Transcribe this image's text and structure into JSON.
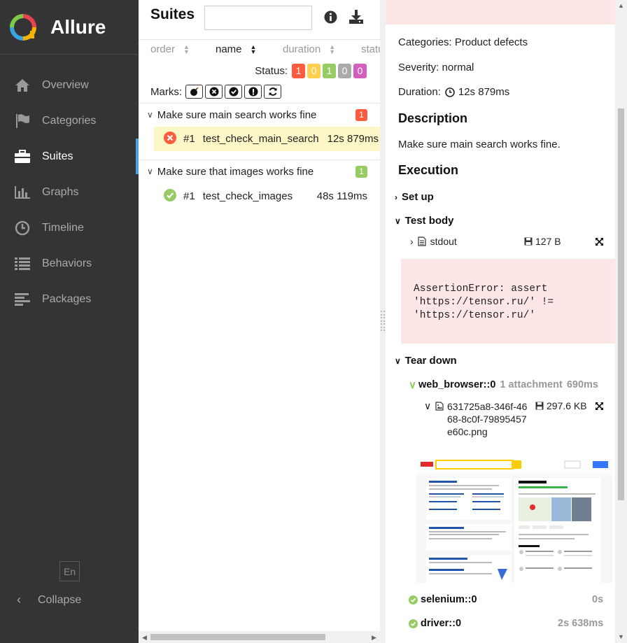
{
  "sidebar": {
    "brand": "Allure",
    "items": [
      {
        "label": "Overview",
        "icon": "home-icon"
      },
      {
        "label": "Categories",
        "icon": "flag-icon"
      },
      {
        "label": "Suites",
        "icon": "briefcase-icon"
      },
      {
        "label": "Graphs",
        "icon": "bar-chart-icon"
      },
      {
        "label": "Timeline",
        "icon": "clock-icon"
      },
      {
        "label": "Behaviors",
        "icon": "list-icon"
      },
      {
        "label": "Packages",
        "icon": "align-left-icon"
      }
    ],
    "active": "Suites",
    "lang": "En",
    "collapse": "Collapse"
  },
  "suites": {
    "title": "Suites",
    "search_placeholder": "",
    "sort": {
      "order": "order",
      "name": "name",
      "duration": "duration",
      "status": "statu"
    },
    "status_label": "Status:",
    "status_counts": [
      {
        "value": "1",
        "color": "#fd5a3e"
      },
      {
        "value": "0",
        "color": "#ffd050"
      },
      {
        "value": "1",
        "color": "#97cc64"
      },
      {
        "value": "0",
        "color": "#aaaaaa"
      },
      {
        "value": "0",
        "color": "#d35ebe"
      }
    ],
    "marks_label": "Marks:",
    "groups": [
      {
        "name": "Make sure main search works fine",
        "count": "1",
        "count_color": "#fd5a3e",
        "tests": [
          {
            "num": "#1",
            "name": "test_check_main_search",
            "duration": "12s 879ms",
            "status": "failed"
          }
        ]
      },
      {
        "name": "Make sure that images works fine",
        "count": "1",
        "count_color": "#97cc64",
        "tests": [
          {
            "num": "#1",
            "name": "test_check_images",
            "duration": "48s 119ms",
            "status": "passed"
          }
        ]
      }
    ]
  },
  "details": {
    "categories": "Categories: Product defects",
    "severity": "Severity: normal",
    "duration_label": "Duration:",
    "duration_value": "12s 879ms",
    "description_title": "Description",
    "description": "Make sure main search works fine.",
    "execution_title": "Execution",
    "setup": "Set up",
    "test_body": "Test body",
    "stdout": {
      "name": "stdout",
      "size": "127 B"
    },
    "error": "AssertionError: assert\n'https://tensor.ru/' !=\n'https://tensor.ru/'",
    "teardown": "Tear down",
    "web_browser": {
      "name": "web_browser::0",
      "meta": "1 attachment",
      "duration": "690ms"
    },
    "png": {
      "name": "631725a8-346f-4668-8c0f-79895457e60c.png",
      "size": "297.6 KB"
    },
    "selenium": {
      "name": "selenium::0",
      "duration": "0s"
    },
    "driver": {
      "name": "driver::0",
      "duration": "2s 638ms"
    }
  },
  "colors": {
    "sidebar": "#343434",
    "accent": "#4aa3df",
    "failed": "#fd5a3e",
    "passed": "#97cc64"
  }
}
